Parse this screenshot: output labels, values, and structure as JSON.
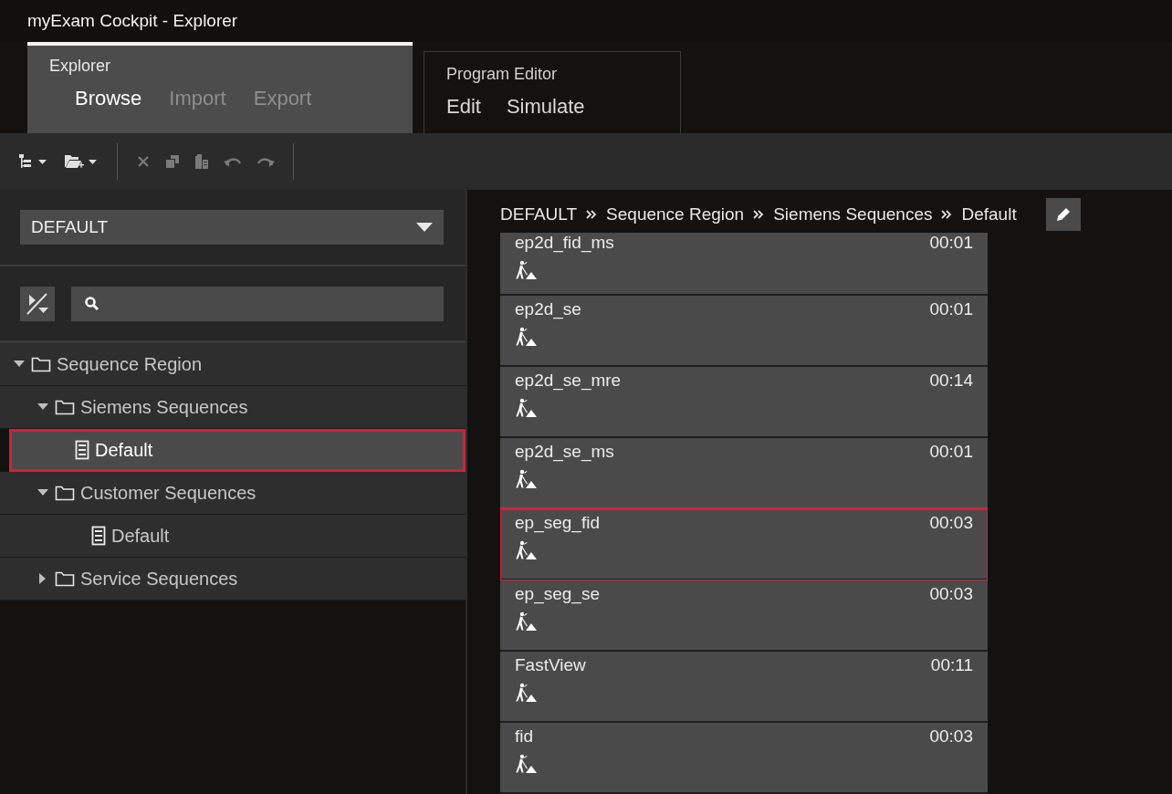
{
  "window": {
    "title": "myExam Cockpit - Explorer"
  },
  "tab_groups": [
    {
      "title": "Explorer",
      "selected": true,
      "items": [
        {
          "label": "Browse",
          "selected": true,
          "disabled": false
        },
        {
          "label": "Import",
          "selected": false,
          "disabled": true
        },
        {
          "label": "Export",
          "selected": false,
          "disabled": true
        }
      ]
    },
    {
      "title": "Program Editor",
      "selected": false,
      "items": [
        {
          "label": "Edit",
          "selected": false,
          "disabled": false
        },
        {
          "label": "Simulate",
          "selected": false,
          "disabled": false
        }
      ]
    }
  ],
  "toolbar": [
    {
      "kind": "tree-menu",
      "disabled": false
    },
    {
      "kind": "new-folder-menu",
      "disabled": false
    },
    {
      "kind": "separator"
    },
    {
      "kind": "delete",
      "disabled": true
    },
    {
      "kind": "copy",
      "disabled": true
    },
    {
      "kind": "paste",
      "disabled": true
    },
    {
      "kind": "undo",
      "disabled": true
    },
    {
      "kind": "redo",
      "disabled": true
    },
    {
      "kind": "separator"
    }
  ],
  "region_dropdown": {
    "value": "DEFAULT"
  },
  "tree": [
    {
      "label": "Sequence Region",
      "kind": "folder",
      "expanded": true,
      "selected": false,
      "highlighted": false,
      "children": [
        {
          "label": "Siemens Sequences",
          "kind": "folder",
          "expanded": true,
          "selected": false,
          "highlighted": false,
          "children": [
            {
              "label": "Default",
              "kind": "sequence",
              "selected": true,
              "highlighted": true
            }
          ]
        },
        {
          "label": "Customer Sequences",
          "kind": "folder",
          "expanded": true,
          "selected": false,
          "highlighted": false,
          "children": [
            {
              "label": "Default",
              "kind": "sequence",
              "selected": false,
              "highlighted": false
            }
          ]
        },
        {
          "label": "Service Sequences",
          "kind": "folder",
          "expanded": false,
          "selected": false,
          "highlighted": false
        }
      ]
    }
  ],
  "breadcrumb": [
    "DEFAULT",
    "Sequence Region",
    "Siemens Sequences",
    "Default"
  ],
  "sequences": [
    {
      "name": "ep2d_fid_ms",
      "duration": "00:01",
      "highlighted": false
    },
    {
      "name": "ep2d_se",
      "duration": "00:01",
      "highlighted": false
    },
    {
      "name": "ep2d_se_mre",
      "duration": "00:14",
      "highlighted": false
    },
    {
      "name": "ep2d_se_ms",
      "duration": "00:01",
      "highlighted": false
    },
    {
      "name": "ep_seg_fid",
      "duration": "00:03",
      "highlighted": true
    },
    {
      "name": "ep_seg_se",
      "duration": "00:03",
      "highlighted": false
    },
    {
      "name": "FastView",
      "duration": "00:11",
      "highlighted": false
    },
    {
      "name": "fid",
      "duration": "00:03",
      "highlighted": false
    }
  ]
}
